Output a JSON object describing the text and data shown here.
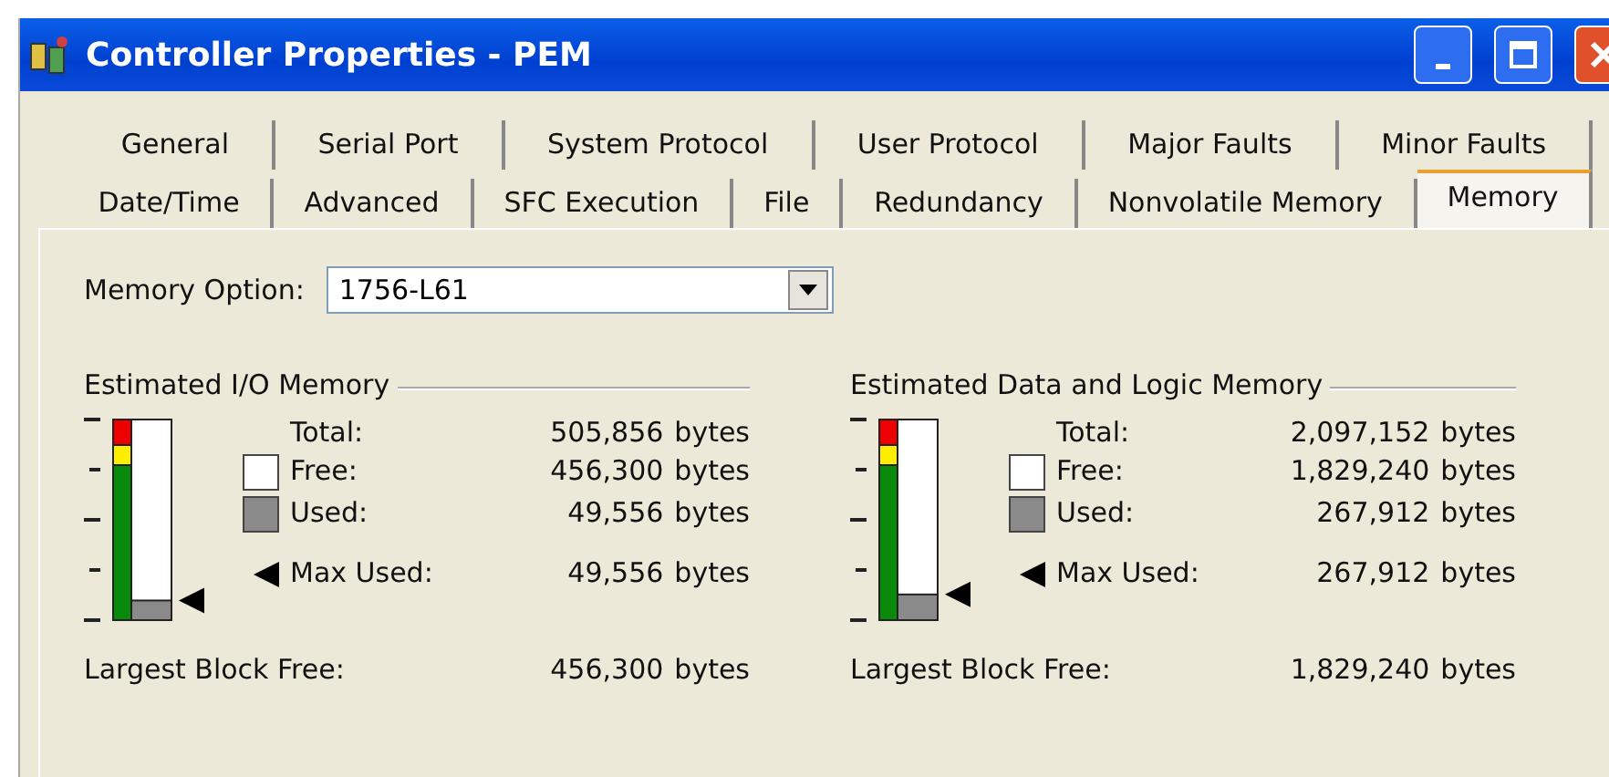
{
  "window": {
    "title": "Controller Properties - PEM"
  },
  "tab_rows": [
    [
      {
        "label": "General",
        "selected": false
      },
      {
        "label": "Serial Port",
        "selected": false
      },
      {
        "label": "System Protocol",
        "selected": false
      },
      {
        "label": "User Protocol",
        "selected": false
      },
      {
        "label": "Major Faults",
        "selected": false
      },
      {
        "label": "Minor Faults",
        "selected": false
      }
    ],
    [
      {
        "label": "Date/Time",
        "selected": false
      },
      {
        "label": "Advanced",
        "selected": false
      },
      {
        "label": "SFC Execution",
        "selected": false
      },
      {
        "label": "File",
        "selected": false
      },
      {
        "label": "Redundancy",
        "selected": false
      },
      {
        "label": "Nonvolatile Memory",
        "selected": false
      },
      {
        "label": "Memory",
        "selected": true
      }
    ]
  ],
  "memory_option": {
    "label": "Memory Option:",
    "value": "1756-L61"
  },
  "sections": [
    {
      "title": "Estimated I/O Memory",
      "level": 0.098,
      "total": {
        "label": "Total:",
        "value": "505,856",
        "unit": "bytes"
      },
      "free": {
        "label": "Free:",
        "value": "456,300",
        "unit": "bytes"
      },
      "used": {
        "label": "Used:",
        "value": "49,556",
        "unit": "bytes"
      },
      "max_used": {
        "label": "Max Used:",
        "value": "49,556",
        "unit": "bytes"
      },
      "largest_block": {
        "label": "Largest Block Free:",
        "value": "456,300",
        "unit": "bytes"
      }
    },
    {
      "title": "Estimated Data and Logic Memory",
      "level": 0.128,
      "total": {
        "label": "Total:",
        "value": "2,097,152",
        "unit": "bytes"
      },
      "free": {
        "label": "Free:",
        "value": "1,829,240",
        "unit": "bytes"
      },
      "used": {
        "label": "Used:",
        "value": "267,912",
        "unit": "bytes"
      },
      "max_used": {
        "label": "Max Used:",
        "value": "267,912",
        "unit": "bytes"
      },
      "largest_block": {
        "label": "Largest Block Free:",
        "value": "1,829,240",
        "unit": "bytes"
      }
    }
  ]
}
